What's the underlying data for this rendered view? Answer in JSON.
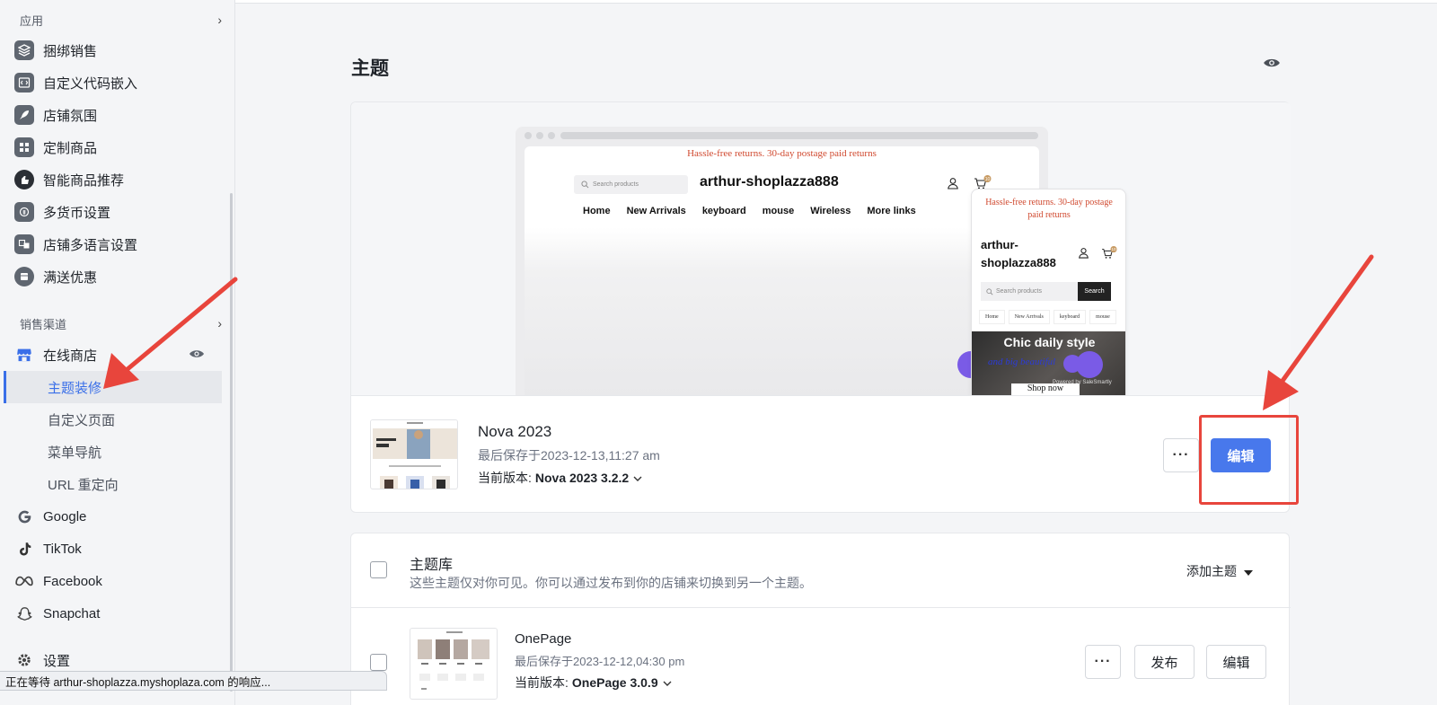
{
  "sidebar": {
    "apps_header": "应用",
    "apps": [
      {
        "label": "捆绑销售",
        "icon": "layers-icon"
      },
      {
        "label": "自定义代码嵌入",
        "icon": "code-icon"
      },
      {
        "label": "店铺氛围",
        "icon": "rocket-icon"
      },
      {
        "label": "定制商品",
        "icon": "grid-icon"
      },
      {
        "label": "智能商品推荐",
        "icon": "thumbs-up-icon"
      },
      {
        "label": "多货币设置",
        "icon": "currency-icon"
      },
      {
        "label": "店铺多语言设置",
        "icon": "translate-icon"
      },
      {
        "label": "满送优惠",
        "icon": "gift-icon"
      }
    ],
    "channels_header": "销售渠道",
    "online_store": "在线商店",
    "online_store_subitems": [
      "主题装修",
      "自定义页面",
      "菜单导航",
      "URL 重定向"
    ],
    "active_subitem": "主题装修",
    "channels": [
      {
        "label": "Google",
        "icon": "google-icon"
      },
      {
        "label": "TikTok",
        "icon": "tiktok-icon"
      },
      {
        "label": "Facebook",
        "icon": "meta-icon"
      },
      {
        "label": "Snapchat",
        "icon": "snapchat-icon"
      }
    ],
    "settings": "设置"
  },
  "page": {
    "title": "主题"
  },
  "preview": {
    "announcement": "Hassle-free returns. 30-day postage paid returns",
    "search_placeholder": "Search products",
    "store_name": "arthur-shoplazza888",
    "cart_count": "10",
    "nav": [
      "Home",
      "New Arrivals",
      "keyboard",
      "mouse",
      "Wireless",
      "More links"
    ],
    "mobile_announcement": "Hassle-free returns. 30-day postage paid returns",
    "mobile_store_name": "arthur-shoplazza888",
    "mobile_search_button": "Search",
    "mobile_nav": [
      "Home",
      "New Arrivals",
      "keyboard",
      "mouse"
    ],
    "hero_title": "Chic daily style",
    "hero_subtitle": "and big beautiful",
    "hero_button": "Shop now",
    "powered_by": "Powered by SaleSmartly"
  },
  "current_theme": {
    "name": "Nova 2023",
    "saved": "最后保存于2023-12-13,11:27 am",
    "version_label": "当前版本:",
    "version_value": "Nova 2023 3.2.2",
    "edit_label": "编辑",
    "more_label": "···"
  },
  "library": {
    "title": "主题库",
    "description": "这些主题仅对你可见。你可以通过发布到你的店铺来切换到另一个主题。",
    "add_theme": "添加主题",
    "themes": [
      {
        "name": "OnePage",
        "saved": "最后保存于2023-12-12,04:30 pm",
        "version_label": "当前版本:",
        "version_value": "OnePage 3.0.9",
        "publish_label": "发布",
        "edit_label": "编辑",
        "more_label": "···"
      }
    ]
  },
  "status_bar": "正在等待 arthur-shoplazza.myshoplaza.com 的响应...",
  "colors": {
    "accent": "#4878ec",
    "highlight": "#e8453c",
    "active_nav": "#3a6fe8"
  }
}
